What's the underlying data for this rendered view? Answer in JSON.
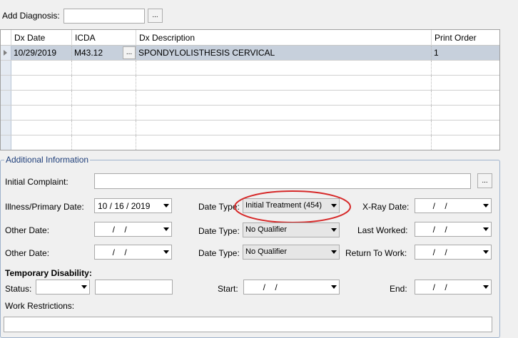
{
  "add_diagnosis": {
    "label": "Add Diagnosis:",
    "value": "",
    "browse_label": "..."
  },
  "grid": {
    "columns": [
      "Dx Date",
      "ICDA",
      "Dx Description",
      "Print Order"
    ],
    "rows": [
      {
        "dx_date": "10/29/2019",
        "icda": "M43.12",
        "browse": "...",
        "description": "SPONDYLOLISTHESIS CERVICAL",
        "print_order": "1"
      }
    ]
  },
  "additional": {
    "title": "Additional Information",
    "initial_complaint_label": "Initial Complaint:",
    "initial_complaint_value": "",
    "initial_complaint_browse": "...",
    "illness_label": "Illness/Primary Date:",
    "illness_value": "10 / 16 / 2019",
    "other_date_label": "Other Date:",
    "other_date1_value": "  /    /",
    "other_date2_value": "  /    /",
    "date_type_label": "Date Type:",
    "date_type_1": "Initial Treatment (454)",
    "date_type_2": "No Qualifier",
    "date_type_3": "No Qualifier",
    "xray_label": "X-Ray Date:",
    "xray_value": "  /    /",
    "last_worked_label": "Last Worked:",
    "last_worked_value": "  /    /",
    "return_label": "Return To Work:",
    "return_value": "  /    /",
    "temp_disability_label": "Temporary Disability:",
    "status_label": "Status:",
    "status_value": "",
    "status_text_value": "",
    "start_label": "Start:",
    "start_value": "  /    /",
    "end_label": "End:",
    "end_value": "  /    /",
    "work_restrictions_label": "Work Restrictions:",
    "work_restrictions_value": ""
  },
  "colors": {
    "highlight_ring": "#d62828",
    "group_title": "#1f3f7a",
    "selected_row": "#c7d0dc"
  }
}
